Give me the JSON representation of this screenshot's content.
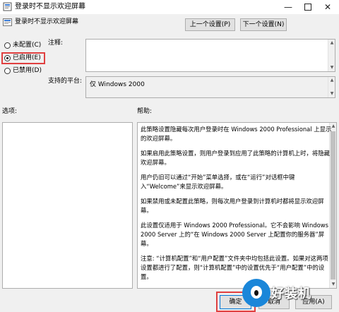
{
  "window": {
    "title": "登录时不显示欢迎屏幕",
    "controls": [
      "minimize",
      "maximize",
      "close"
    ]
  },
  "policy": {
    "name": "登录时不显示欢迎屏幕",
    "prev_label": "上一个设置(P)",
    "next_label": "下一个设置(N)"
  },
  "options": {
    "not_configured": "未配置(C)",
    "enabled": "已启用(E)",
    "disabled": "已禁用(D)",
    "selected": "enabled"
  },
  "fields": {
    "comment_label": "注释:",
    "comment_value": "",
    "platform_label": "支持的平台:",
    "platform_value": "仅 Windows 2000",
    "options_label": "选项:",
    "help_label": "帮助:"
  },
  "help": {
    "paragraphs": [
      "此策略设置隐藏每次用户登录时在 Windows 2000 Professional 上显示的欢迎屏幕。",
      "如果启用此策略设置，则用户登录到应用了此策略的计算机上时，将隐藏欢迎屏幕。",
      "用户仍旧可以通过“开始”菜单选择，或在“运行”对话框中键入“Welcome”来显示欢迎屏幕。",
      "如果禁用或未配置此策略，则每次用户登录到计算机时都将显示欢迎屏幕。",
      "此设置仅适用于 Windows 2000 Professional。它不会影响 Windows 2000 Server 上的“在 Windows 2000 Server 上配置你的服务器”屏幕。",
      "注意: “计算机配置”和“用户配置”文件夹中均包括此设置。如果对这两项设置都进行了配置，则“计算机配置”中的设置优先于“用户配置”中的设置。"
    ]
  },
  "buttons": {
    "ok": "确定",
    "cancel": "取消",
    "apply": "应用(A)"
  },
  "watermark": {
    "text": "好装机"
  },
  "colors": {
    "highlight": "#e04040",
    "accent": "#0078d7"
  }
}
